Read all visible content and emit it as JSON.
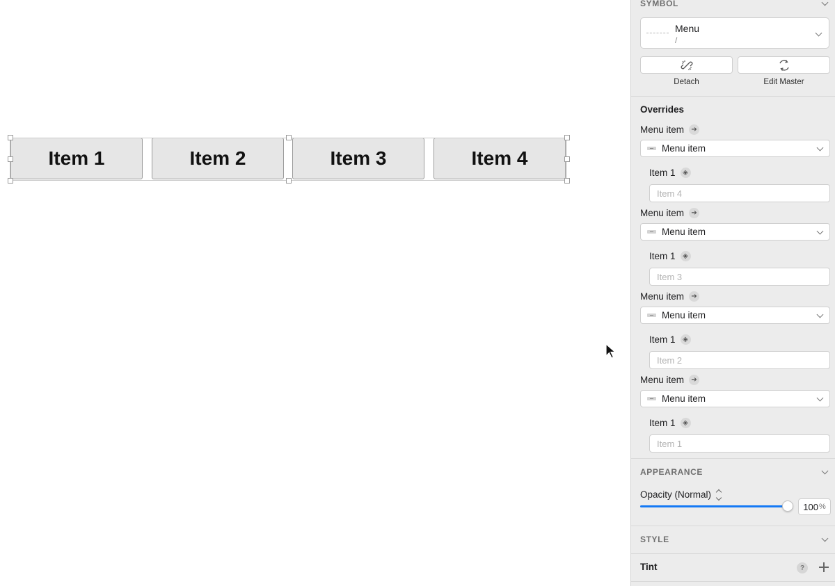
{
  "canvas": {
    "menu_items": [
      "Item 1",
      "Item 2",
      "Item 3",
      "Item 4"
    ]
  },
  "inspector": {
    "symbol": {
      "header": "SYMBOL",
      "name": "Menu",
      "path": "/",
      "detach_label": "Detach",
      "edit_master_label": "Edit Master"
    },
    "overrides": {
      "title": "Overrides",
      "groups": [
        {
          "label": "Menu item",
          "dropdown": "Menu item",
          "sub_label": "Item 1",
          "placeholder": "Item 4"
        },
        {
          "label": "Menu item",
          "dropdown": "Menu item",
          "sub_label": "Item 1",
          "placeholder": "Item 3"
        },
        {
          "label": "Menu item",
          "dropdown": "Menu item",
          "sub_label": "Item 1",
          "placeholder": "Item 2"
        },
        {
          "label": "Menu item",
          "dropdown": "Menu item",
          "sub_label": "Item 1",
          "placeholder": "Item 1"
        }
      ]
    },
    "appearance": {
      "header": "APPEARANCE",
      "opacity_label": "Opacity (Normal)",
      "opacity_value": "100",
      "opacity_unit": "%"
    },
    "style": {
      "header": "STYLE"
    },
    "tint": {
      "title": "Tint",
      "help_glyph": "?"
    }
  },
  "colors": {
    "accent": "#1479f5",
    "panel_bg": "#ececec",
    "menu_item_bg": "#e6e6e6"
  },
  "icons": [
    "arrow-right-icon",
    "layers-icon",
    "chevron-down-icon",
    "unlink-icon",
    "refresh-icon",
    "stepper-icon",
    "help-icon",
    "plus-icon",
    "cursor-icon"
  ]
}
